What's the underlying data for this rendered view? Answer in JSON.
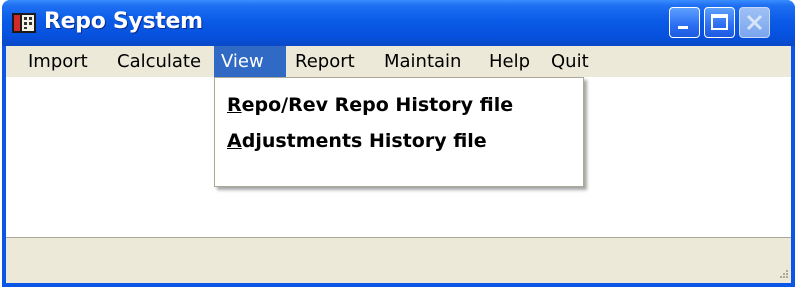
{
  "window": {
    "title": "Repo System",
    "icon": "repo-app-icon",
    "controls": [
      "minimize-icon",
      "maximize-icon",
      "close-icon"
    ]
  },
  "menubar": {
    "items": [
      {
        "label": "Import"
      },
      {
        "label": "Calculate"
      },
      {
        "label": "View",
        "active": true
      },
      {
        "label": "Report"
      },
      {
        "label": "Maintain"
      },
      {
        "label": "Help"
      },
      {
        "label": "Quit"
      }
    ]
  },
  "view_menu": {
    "items": [
      {
        "mnemonic": "R",
        "rest": "epo/Rev Repo History file"
      },
      {
        "mnemonic": "A",
        "rest": "djustments History file"
      }
    ]
  },
  "colors": {
    "titlebar": "#0A56E6",
    "menu_highlight": "#316AC5",
    "chrome": "#ECE9D8"
  }
}
